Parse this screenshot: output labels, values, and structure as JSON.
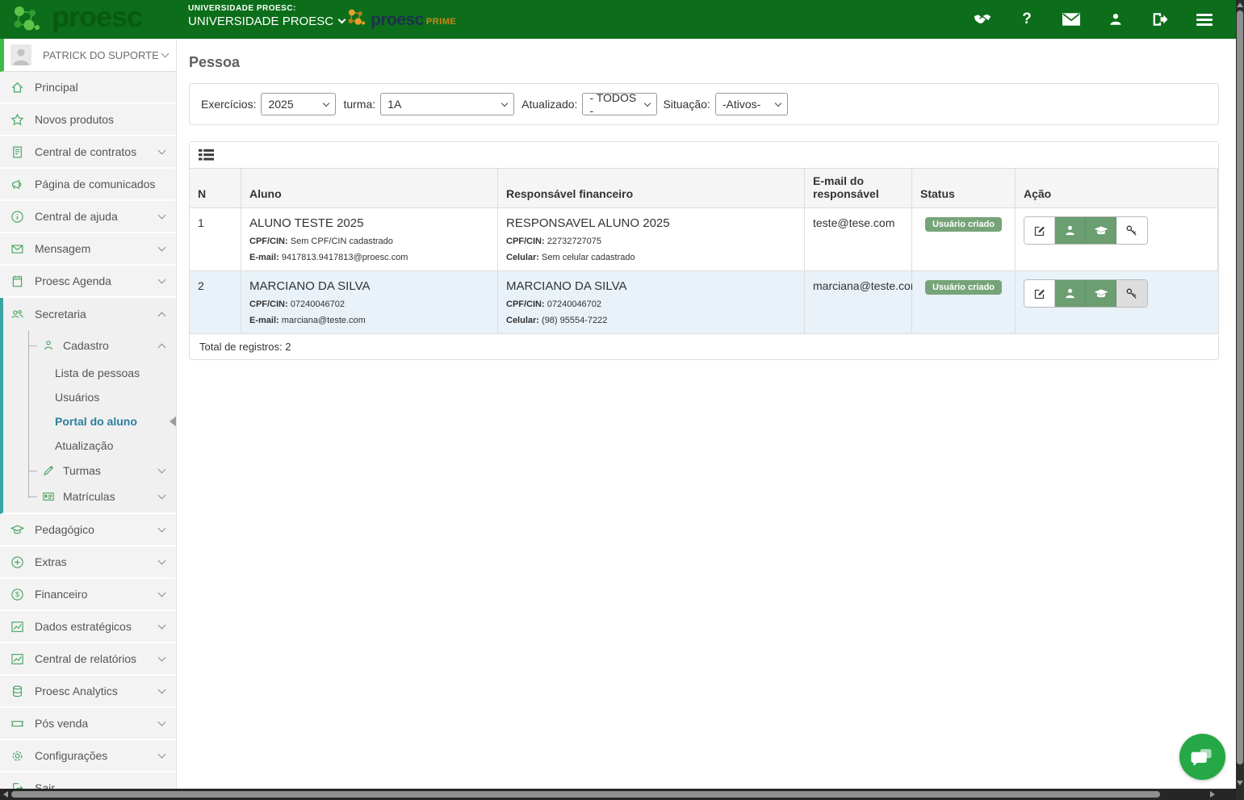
{
  "topbar": {
    "brand": "proesc",
    "school_label": "UNIVERSIDADE PROESC:",
    "school_name": "UNIVERSIDADE PROESC",
    "prime": {
      "brand": "proesc",
      "suffix": "PRIME"
    },
    "icons": [
      "handshake-support",
      "help",
      "mail",
      "account",
      "logout",
      "menu"
    ]
  },
  "sidebar": {
    "user": {
      "name": "PATRICK DO SUPORTE"
    },
    "items": [
      {
        "label": "Principal",
        "icon": "home"
      },
      {
        "label": "Novos produtos",
        "icon": "star"
      },
      {
        "label": "Central de contratos",
        "icon": "contract"
      },
      {
        "label": "Página de comunicados",
        "icon": "megaphone"
      },
      {
        "label": "Central de ajuda",
        "icon": "info"
      },
      {
        "label": "Mensagem",
        "icon": "mail"
      },
      {
        "label": "Proesc Agenda",
        "icon": "calendar"
      }
    ],
    "secretaria": {
      "label": "Secretaria",
      "icon": "users",
      "cadastro": {
        "label": "Cadastro",
        "icon": "person",
        "items": [
          {
            "label": "Lista de pessoas",
            "active": false
          },
          {
            "label": "Usuários",
            "active": false
          },
          {
            "label": "Portal do aluno",
            "active": true
          },
          {
            "label": "Atualização",
            "active": false
          }
        ]
      },
      "turmas": {
        "label": "Turmas",
        "icon": "pencil"
      },
      "matriculas": {
        "label": "Matrículas",
        "icon": "id-card"
      }
    },
    "items_bottom": [
      {
        "label": "Pedagógico",
        "icon": "graduation-cap"
      },
      {
        "label": "Extras",
        "icon": "plus-circle"
      },
      {
        "label": "Financeiro",
        "icon": "dollar-circle"
      },
      {
        "label": "Dados estratégicos",
        "icon": "chart"
      },
      {
        "label": "Central de relatórios",
        "icon": "chart"
      },
      {
        "label": "Proesc Analytics",
        "icon": "database"
      },
      {
        "label": "Pós venda",
        "icon": "ticket"
      },
      {
        "label": "Configurações",
        "icon": "gear"
      },
      {
        "label": "Sair",
        "icon": "sign-out"
      }
    ]
  },
  "main": {
    "title": "Pessoa",
    "filters": {
      "exercicios": {
        "label": "Exercícios:",
        "value": "2025"
      },
      "turma": {
        "label": "turma:",
        "value": "1A"
      },
      "atualizado": {
        "label": "Atualizado:",
        "value": "- TODOS -"
      },
      "situacao": {
        "label": "Situação:",
        "value": "-Ativos-"
      }
    },
    "table": {
      "columns": {
        "n": "N",
        "aluno": "Aluno",
        "resp": "Responsável financeiro",
        "email": "E-mail do responsável",
        "status": "Status",
        "acao": "Ação"
      },
      "rows": [
        {
          "n": "1",
          "aluno_nome": "ALUNO TESTE 2025",
          "aluno_cpf_label": "CPF/CIN:",
          "aluno_cpf": "Sem CPF/CIN cadastrado",
          "aluno_email_label": "E-mail:",
          "aluno_email": "9417813.9417813@proesc.com",
          "resp_nome": "RESPONSAVEL ALUNO 2025",
          "resp_cpf_label": "CPF/CIN:",
          "resp_cpf": "22732727075",
          "resp_cel_label": "Celular:",
          "resp_cel": "Sem celular cadastrado",
          "email_resp": "teste@tese.com",
          "status": "Usuário criado"
        },
        {
          "n": "2",
          "aluno_nome": "MARCIANO DA SILVA",
          "aluno_cpf_label": "CPF/CIN:",
          "aluno_cpf": "07240046702",
          "aluno_email_label": "E-mail:",
          "aluno_email": "marciana@teste.com",
          "resp_nome": "MARCIANO DA SILVA",
          "resp_cpf_label": "CPF/CIN:",
          "resp_cpf": "07240046702",
          "resp_cel_label": "Celular:",
          "resp_cel": "(98) 95554-7222",
          "email_resp": "marciana@teste.com",
          "status": "Usuário criado"
        }
      ],
      "footer_total": "Total de registros: 2"
    }
  },
  "colors": {
    "topbar_green": "#0c6e1a",
    "brand_light_green": "#5dc449",
    "prime_orange": "#e6a02a",
    "active_link": "#2e7e9e",
    "secretaria_accent": "#3aa3a3",
    "badge_green": "#76a478",
    "action_green": "#6b9e71",
    "chat_green": "#25a845",
    "row_alt_blue": "#e9f2f9"
  }
}
